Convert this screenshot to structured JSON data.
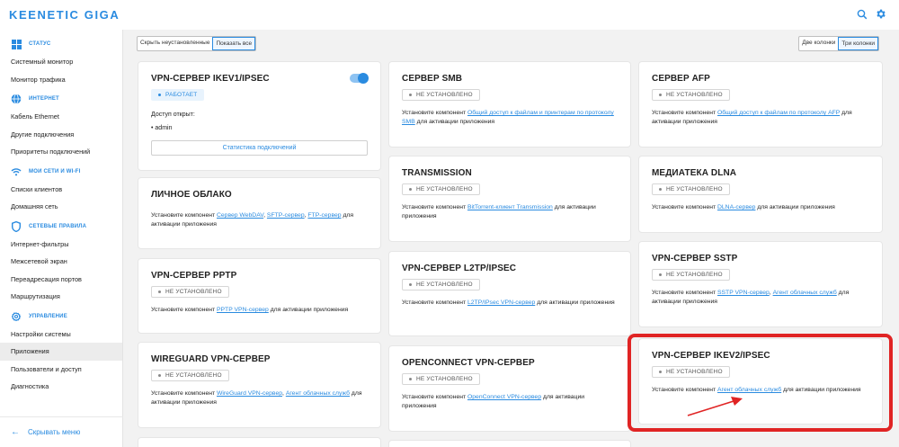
{
  "header": {
    "logo": "KEENETIC GIGA"
  },
  "sidebar": {
    "sections": [
      {
        "label": "СТАТУС",
        "icon": "status-icon",
        "items": [
          "Системный монитор",
          "Монитор трафика"
        ]
      },
      {
        "label": "ИНТЕРНЕТ",
        "icon": "globe-icon",
        "items": [
          "Кабель Ethernet",
          "Другие подключения",
          "Приоритеты подключений"
        ]
      },
      {
        "label": "МОИ СЕТИ И WI-FI",
        "icon": "wifi-icon",
        "items": [
          "Списки клиентов",
          "Домашняя сеть"
        ]
      },
      {
        "label": "СЕТЕВЫЕ ПРАВИЛА",
        "icon": "shield-icon",
        "items": [
          "Интернет-фильтры",
          "Межсетевой экран",
          "Переадресация портов",
          "Маршрутизация"
        ]
      },
      {
        "label": "УПРАВЛЕНИЕ",
        "icon": "gear-icon",
        "items": [
          "Настройки системы",
          "Приложения",
          "Пользователи и доступ",
          "Диагностика"
        ]
      }
    ],
    "active_item": "Приложения",
    "footer": "Скрывать меню"
  },
  "filters": {
    "hide": "Скрыть неустановленные",
    "show_all": "Показать все",
    "two_cols": "Две колонки",
    "three_cols": "Три колонки"
  },
  "status": {
    "running": "РАБОТАЕТ",
    "not_installed": "НЕ УСТАНОВЛЕНО"
  },
  "common": {
    "install": "Установите компонент",
    "for_activation": "для активации приложения",
    "sep": ", "
  },
  "cards": {
    "ikev1": {
      "title": "VPN-СЕРВЕР IKEV1/IPSEC",
      "access_label": "Доступ открыт:",
      "user": "admin",
      "stats_button": "Статистика подключений"
    },
    "cloud": {
      "title": "ЛИЧНОЕ ОБЛАКО",
      "links": [
        "Сервер WebDAV",
        "SFTP-сервер",
        "FTP-сервер"
      ]
    },
    "pptp": {
      "title": "VPN-СЕРВЕР PPTP",
      "links": [
        "PPTP VPN-сервер"
      ]
    },
    "wireguard": {
      "title": "WIREGUARD VPN-СЕРВЕР",
      "links": [
        "WireGuard VPN-сервер",
        "Агент облачных служб"
      ]
    },
    "smb": {
      "title": "СЕРВЕР SMB",
      "links": [
        "Общий доступ к файлам и принтерам по протоколу SMB"
      ]
    },
    "transmission": {
      "title": "TRANSMISSION",
      "links": [
        "BitTorrent-клиент Transmission"
      ]
    },
    "l2tp": {
      "title": "VPN-СЕРВЕР L2TP/IPSEC",
      "links": [
        "L2TP/IPsec VPN-сервер"
      ]
    },
    "openconnect": {
      "title": "OPENCONNECT VPN-СЕРВЕР",
      "links": [
        "OpenConnect VPN-сервер"
      ]
    },
    "afp": {
      "title": "СЕРВЕР AFP",
      "links": [
        "Общий доступ к файлам по протоколу AFP"
      ]
    },
    "dlna": {
      "title": "МЕДИАТЕКА DLNA",
      "links": [
        "DLNA-сервер"
      ]
    },
    "sstp": {
      "title": "VPN-СЕРВЕР SSTP",
      "links": [
        "SSTP VPN-сервер",
        "Агент облачных служб"
      ]
    },
    "ikev2": {
      "title": "VPN-СЕРВЕР IKEV2/IPSEC",
      "links": [
        "Агент облачных служб"
      ]
    }
  },
  "colors": {
    "accent": "#2a8be0",
    "highlight": "#e02424"
  }
}
